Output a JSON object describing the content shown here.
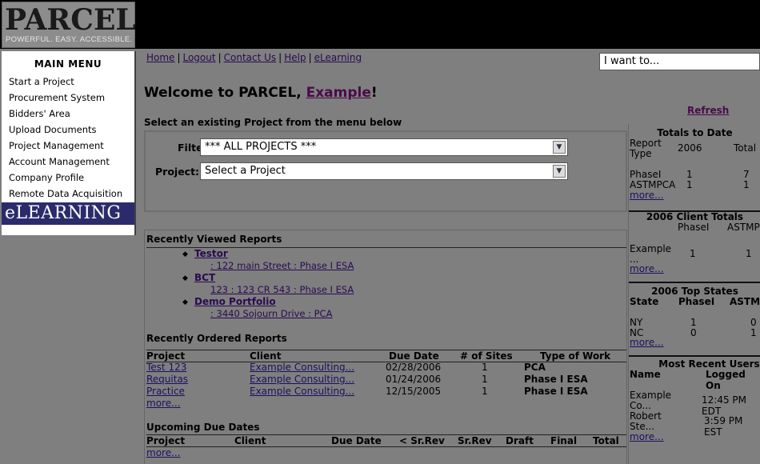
{
  "logo": {
    "name": "PARCEL",
    "tagline": "POWERFUL. EASY. ACCESSIBLE."
  },
  "menu": {
    "title": "MAIN MENU",
    "items": [
      "Start a Project",
      "Procurement System",
      "Bidders' Area",
      "Upload Documents",
      "Project Management",
      "Account Management",
      "Company Profile",
      "Remote Data Acquisition"
    ],
    "elearning": "eLEARNING"
  },
  "toplinks": [
    "Home",
    "Logout",
    "Contact Us",
    "Help",
    "eLearning"
  ],
  "iwant": {
    "placeholder": "I want to..."
  },
  "welcome": {
    "prefix": "Welcome to PARCEL, ",
    "user": "Example",
    "suffix": "!"
  },
  "refresh": "Refresh",
  "select_label": "Select an existing Project from the menu below",
  "filter": {
    "label": "Filter:",
    "value": "*** ALL PROJECTS ***"
  },
  "project": {
    "label": "Project:",
    "value": "Select a Project"
  },
  "recently_viewed": {
    "title": "Recently Viewed Reports",
    "items": [
      {
        "name": "Testor",
        "sub": ": 122 main Street : Phase I ESA"
      },
      {
        "name": "BCT",
        "sub": "123 : 123 CR 543 : Phase I ESA"
      },
      {
        "name": "Demo Portfolio",
        "sub": ": 3440 Sojourn Drive : PCA"
      }
    ]
  },
  "recently_ordered": {
    "title": "Recently Ordered Reports",
    "headers": [
      "Project",
      "Client",
      "Due Date",
      "# of Sites",
      "Type of Work"
    ],
    "rows": [
      [
        "Test 123",
        "Example Consulting...",
        "02/28/2006",
        "1",
        "PCA"
      ],
      [
        "Requitas",
        "Example Consulting...",
        "01/24/2006",
        "1",
        "Phase I ESA"
      ],
      [
        "Practice",
        "Example Consulting...",
        "12/15/2005",
        "1",
        "Phase I ESA"
      ]
    ],
    "more": "more..."
  },
  "upcoming": {
    "title": "Upcoming Due Dates",
    "headers": [
      "Project",
      "Client",
      "Due Date",
      "< Sr.Rev",
      "Sr.Rev",
      "Draft",
      "Final",
      "Total"
    ],
    "more": "more..."
  },
  "totals": {
    "title": "Totals to Date",
    "head_report": "Report",
    "head_type": "Type",
    "head_year": "2006",
    "head_total": "Total",
    "rows": [
      [
        "PhaseI",
        "1",
        "7"
      ],
      [
        "ASTMPCA",
        "1",
        "1"
      ]
    ],
    "more": "more..."
  },
  "client_totals": {
    "title": "2006 Client Totals",
    "headers": [
      "PhaseI",
      "ASTMPC"
    ],
    "row_name1": "Example",
    "row_name2": "...",
    "values": [
      "1",
      "1"
    ],
    "more": "more..."
  },
  "top_states": {
    "title": "2006 Top States",
    "headers": [
      "State",
      "PhaseI",
      "ASTMP"
    ],
    "rows": [
      [
        "NY",
        "1",
        "0"
      ],
      [
        "NC",
        "0",
        "1"
      ]
    ],
    "more": "more..."
  },
  "recent_users": {
    "title": "Most Recent Users",
    "headers": [
      "Name",
      "Logged On"
    ],
    "rows": [
      {
        "name1": "Example",
        "name2": "Co...",
        "time": "12:45 PM EDT"
      },
      {
        "name1": "Robert",
        "name2": "Ste...",
        "time": "3:59 PM EST"
      }
    ],
    "more": "more..."
  }
}
